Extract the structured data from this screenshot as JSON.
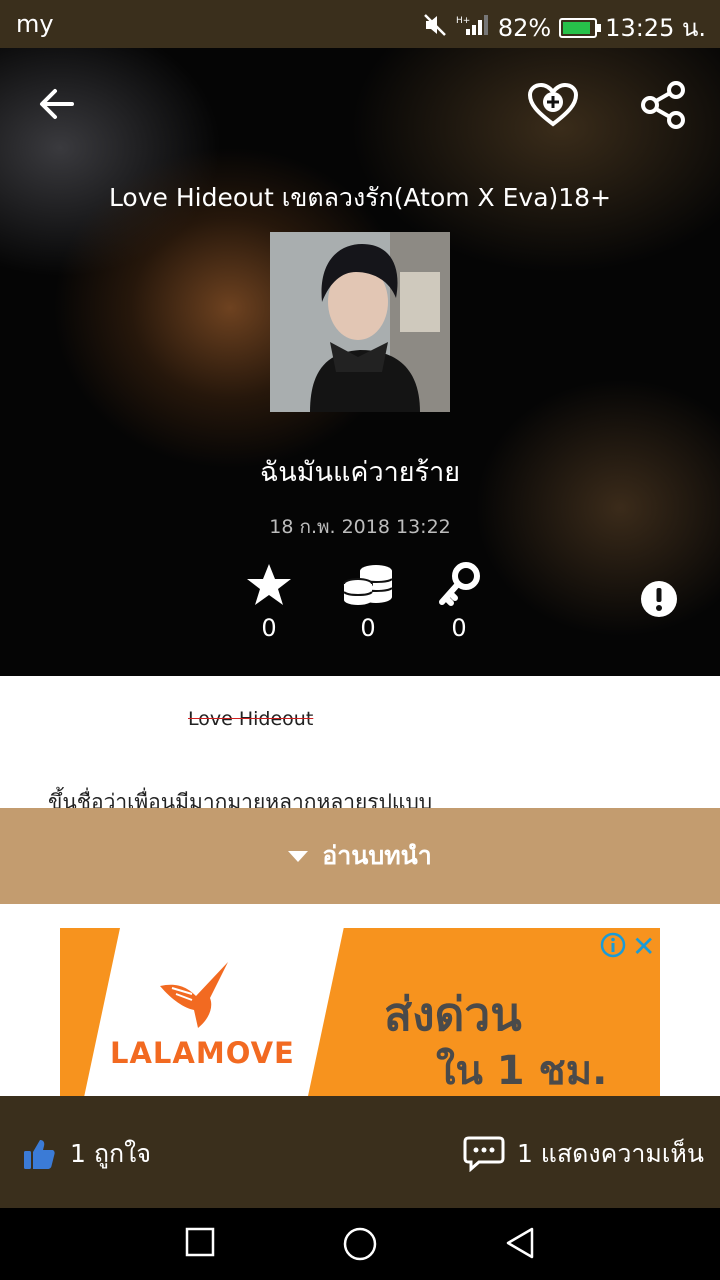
{
  "status_bar": {
    "carrier": "my",
    "battery_percent": "82%",
    "time": "13:25 น."
  },
  "header": {
    "title": "Love Hideout เขตลวงรัก(Atom X Eva)18+",
    "author": "ฉันมันแค่วายร้าย",
    "date": "18 ก.พ. 2018 13:22"
  },
  "stats": {
    "stars": "0",
    "coins": "0",
    "keys": "0"
  },
  "content": {
    "story_name": "Love Hideout",
    "first_line": "ขึ้นชื่อว่าเพื่อนมีมากมายหลากหลายรูปแบบ"
  },
  "read_intro_label": "อ่านบทนำ",
  "ad": {
    "brand": "LALAMOVE",
    "headline": "ส่งด่วน",
    "subline": "ใน 1 ชม."
  },
  "footer": {
    "likes": "1 ถูกใจ",
    "comments": "1 แสดงความเห็น"
  },
  "colors": {
    "status_bg": "#3a2f1c",
    "read_bar": "#c39c6f",
    "ad_orange": "#f7931e",
    "like_blue": "#3b7bd6"
  }
}
